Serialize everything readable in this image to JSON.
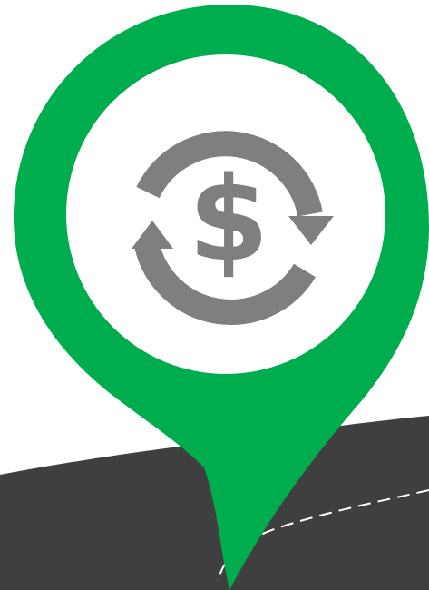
{
  "illustration": {
    "icon": "dollar-exchange-icon",
    "symbol": "$",
    "colors": {
      "background": "#ffffff",
      "pin": "#00ad4e",
      "pin_inner": "#ffffff",
      "icon": "#7f7f7f",
      "road": "#3f3f3f",
      "road_marking": "#ffffff"
    }
  }
}
